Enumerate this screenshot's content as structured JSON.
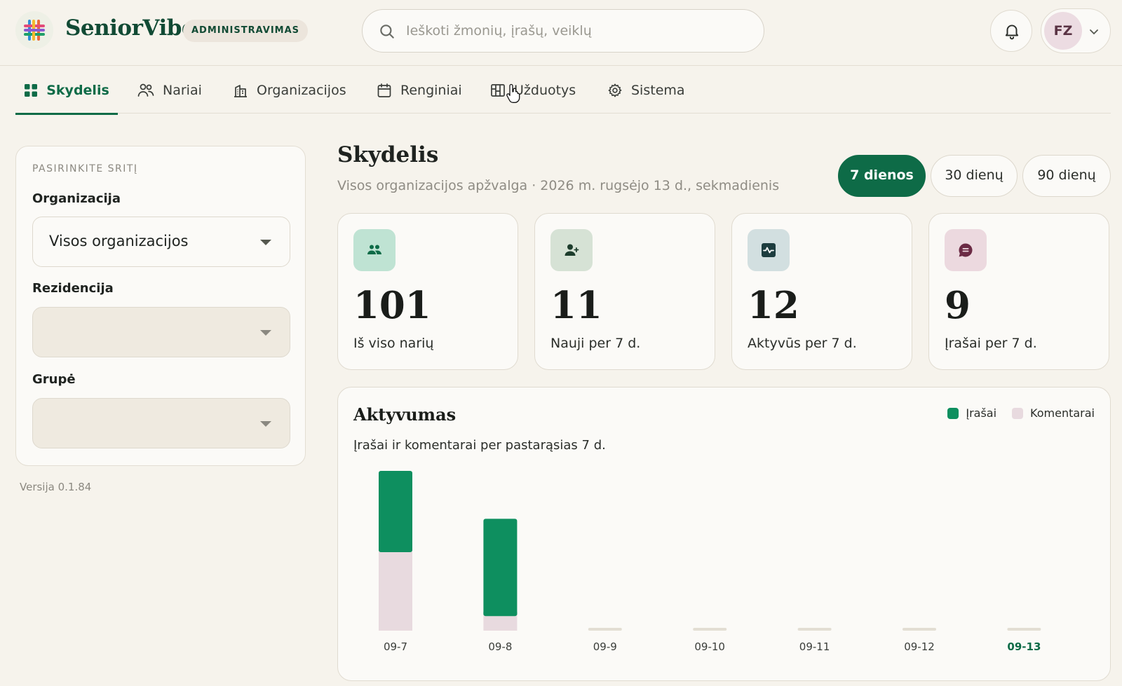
{
  "header": {
    "brand": "SeniorVibe",
    "badge": "ADMINISTRAVIMAS",
    "search_placeholder": "Ieškoti žmonių, įrašų, veiklų",
    "user_initials": "FZ"
  },
  "nav": {
    "tabs": [
      {
        "label": "Skydelis",
        "icon": "grid-icon",
        "active": true
      },
      {
        "label": "Nariai",
        "icon": "users-icon"
      },
      {
        "label": "Organizacijos",
        "icon": "building-icon"
      },
      {
        "label": "Renginiai",
        "icon": "calendar-icon"
      },
      {
        "label": "Užduotys",
        "icon": "kanban-icon"
      },
      {
        "label": "Sistema",
        "icon": "gear-icon"
      }
    ]
  },
  "sidebar": {
    "title": "PASIRINKITE SRITĮ",
    "org_label": "Organizacija",
    "org_value": "Visos organizacijos",
    "residence_label": "Rezidencija",
    "residence_value": "",
    "group_label": "Grupė",
    "group_value": "",
    "version": "Versija 0.1.84"
  },
  "main": {
    "title": "Skydelis",
    "subtitle": "Visos organizacijos apžvalga · 2026 m. rugsėjo 13 d., sekmadienis",
    "ranges": [
      {
        "label": "7 dienos",
        "active": true
      },
      {
        "label": "30 dienų"
      },
      {
        "label": "90 dienų"
      }
    ],
    "stats": [
      {
        "value": "101",
        "label": "Iš viso narių",
        "icon": "members-icon",
        "icon_bg": "#bfe3d3",
        "icon_color": "#0e6b47"
      },
      {
        "value": "11",
        "label": "Nauji per 7 d.",
        "icon": "user-plus-icon",
        "icon_bg": "#d6e2d5",
        "icon_color": "#1d3d2c"
      },
      {
        "value": "12",
        "label": "Aktyvūs per 7 d.",
        "icon": "activity-icon",
        "icon_bg": "#d2dfe0",
        "icon_color": "#1d3d3f"
      },
      {
        "value": "9",
        "label": "Įrašai per 7 d.",
        "icon": "message-icon",
        "icon_bg": "#ecd9df",
        "icon_color": "#6b2a44"
      }
    ]
  },
  "chart_data": {
    "type": "bar",
    "stacked": true,
    "title": "Aktyvumas",
    "subtitle": "Įrašai ir komentarai per pastarąsias 7 d.",
    "categories": [
      "09-7",
      "09-8",
      "09-9",
      "09-10",
      "09-11",
      "09-12",
      "09-13"
    ],
    "highlighted_category": "09-13",
    "series": [
      {
        "name": "Komentarai",
        "color": "#e8dadf",
        "values": [
          5,
          1,
          0,
          0,
          0,
          0,
          0
        ]
      },
      {
        "name": "Įrašai",
        "color": "#0e8f5f",
        "values": [
          5,
          6,
          0,
          0,
          0,
          0,
          0
        ]
      }
    ],
    "legend_position": "top-right"
  }
}
